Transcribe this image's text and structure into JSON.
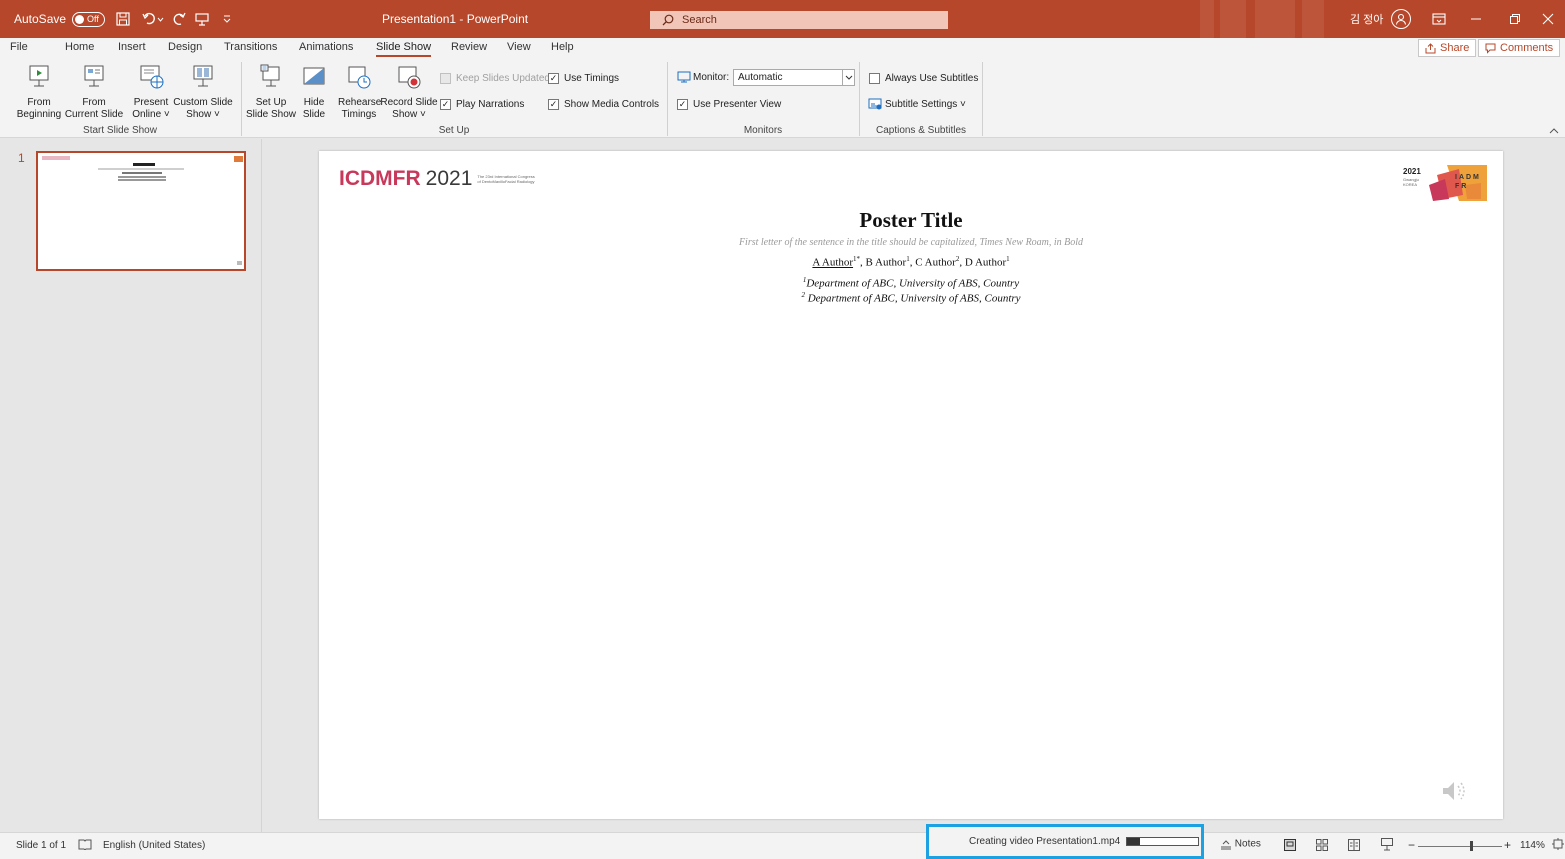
{
  "titlebar": {
    "autosave_label": "AutoSave",
    "autosave_state": "Off",
    "doc_title": "Presentation1 - PowerPoint",
    "search_placeholder": "Search",
    "user_name": "김 정아"
  },
  "tabs": [
    "File",
    "Home",
    "Insert",
    "Design",
    "Transitions",
    "Animations",
    "Slide Show",
    "Review",
    "View",
    "Help"
  ],
  "active_tab": "Slide Show",
  "share_label": "Share",
  "comments_label": "Comments",
  "ribbon": {
    "start": {
      "from_beginning": [
        "From",
        "Beginning"
      ],
      "from_current": [
        "From",
        "Current Slide"
      ],
      "present_online": [
        "Present",
        "Online ˅"
      ],
      "custom_show": [
        "Custom Slide",
        "Show ˅"
      ],
      "group_label": "Start Slide Show"
    },
    "setup": {
      "setup_show": [
        "Set Up",
        "Slide Show"
      ],
      "hide_slide": [
        "Hide",
        "Slide"
      ],
      "rehearse": [
        "Rehearse",
        "Timings"
      ],
      "record": [
        "Record Slide",
        "Show ˅"
      ],
      "keep_updated": "Keep Slides Updated",
      "use_timings": "Use Timings",
      "play_narrations": "Play Narrations",
      "show_media": "Show Media Controls",
      "group_label": "Set Up"
    },
    "monitors": {
      "monitor_label": "Monitor:",
      "monitor_value": "Automatic",
      "presenter_view": "Use Presenter View",
      "group_label": "Monitors"
    },
    "captions": {
      "always_subtitles": "Always Use Subtitles",
      "subtitle_settings": "Subtitle Settings ˅",
      "group_label": "Captions & Subtitles"
    }
  },
  "thumbnail": {
    "number": "1"
  },
  "slide": {
    "logo_main": "ICDMFR",
    "logo_year": "2021",
    "logo_tagline": "The 23rd International Congress of DentoMaxilloFacial Radiology",
    "badge_year": "2021",
    "badge_place": "Gwangju KOREA",
    "badge_letters": "IADMFR",
    "title": "Poster Title",
    "subtitle": "First letter of the sentence in the title should be capitalized, Times New Roam, in Bold",
    "authors": [
      {
        "name": "A Author",
        "sup": "1*",
        "underline": true
      },
      {
        "name": "B Author",
        "sup": "1"
      },
      {
        "name": "C Author",
        "sup": "2"
      },
      {
        "name": "D Author",
        "sup": "1"
      }
    ],
    "aff1_sup": "1",
    "aff1": "Department of ABC, University of ABS, Country",
    "aff2_sup": "2",
    "aff2": " Department of ABC, University of ABS, Country"
  },
  "status": {
    "slide_counter": "Slide 1 of 1",
    "language": "English (United States)",
    "video_progress_text": "Creating video Presentation1.mp4",
    "video_progress_fraction": 0.18,
    "notes_label": "Notes",
    "zoom_level": "114%",
    "zoom_fraction": 0.62
  },
  "colors": {
    "accent": "#b7472a",
    "highlight_box": "#1ca1e2",
    "logo_pink": "#c7385a"
  }
}
